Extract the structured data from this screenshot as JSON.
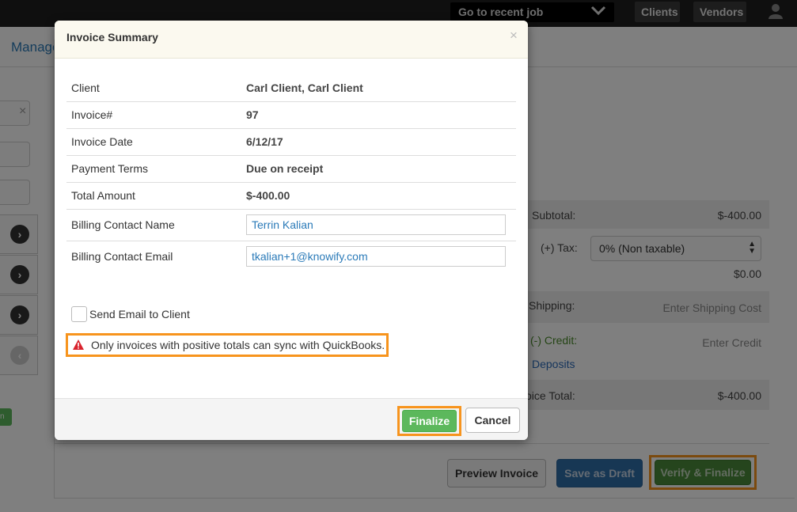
{
  "topbar": {
    "recent_job": "Go to recent job",
    "clients": "Clients",
    "vendors": "Vendors"
  },
  "background": {
    "manage_label": "Manage",
    "summary": {
      "subtotal_label": "Subtotal:",
      "subtotal_value": "$-400.00",
      "tax_label": "(+) Tax:",
      "tax_option": "0% (Non taxable)",
      "tax_amount": "$0.00",
      "shipping_label": "Shipping:",
      "shipping_placeholder": "Enter Shipping Cost",
      "credit_label": "(-) Credit:",
      "credit_placeholder": "Enter Credit",
      "deposits_link": "Deposits",
      "total_label": "oice Total:",
      "total_value": "$-400.00"
    },
    "buttons": {
      "preview": "Preview Invoice",
      "draft": "Save as Draft",
      "verify": "Verify & Finalize"
    },
    "left_green_label": "n"
  },
  "modal": {
    "title": "Invoice Summary",
    "close": "×",
    "rows": [
      {
        "label": "Client",
        "value": "Carl Client, Carl Client"
      },
      {
        "label": "Invoice#",
        "value": "97"
      },
      {
        "label": "Invoice Date",
        "value": "6/12/17"
      },
      {
        "label": "Payment Terms",
        "value": "Due on receipt"
      },
      {
        "label": "Total Amount",
        "value": "$-400.00"
      }
    ],
    "billing_contact_name": {
      "label": "Billing Contact Name",
      "value": "Terrin Kalian"
    },
    "billing_contact_email": {
      "label": "Billing Contact Email",
      "value": "tkalian+1@knowify.com"
    },
    "send_email_label": "Send Email to Client",
    "warning": "Only invoices with positive totals can sync with QuickBooks.",
    "finalize": "Finalize",
    "cancel": "Cancel"
  },
  "colors": {
    "highlight": "#f7941d",
    "finalize": "#5cb85c",
    "link": "#2a7ab8",
    "warning_icon": "#d9232d"
  }
}
